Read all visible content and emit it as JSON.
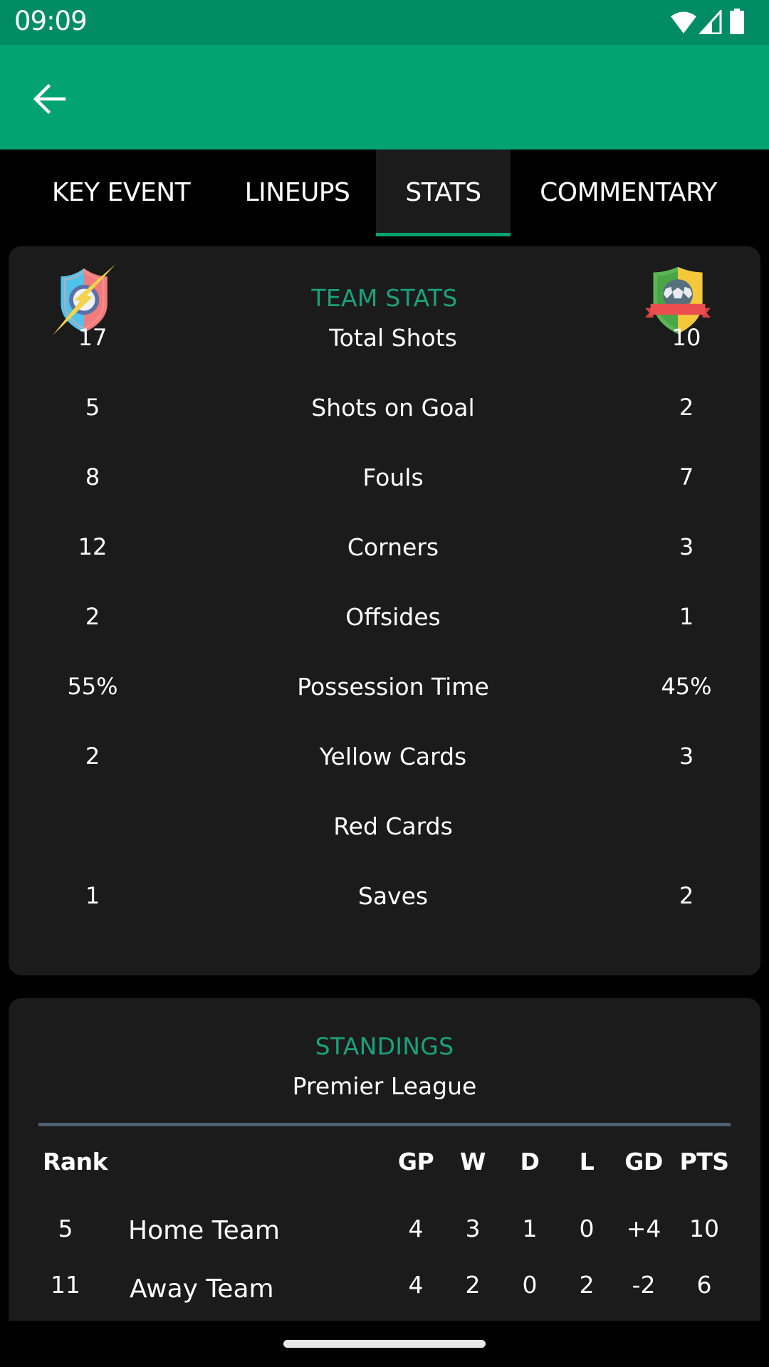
{
  "status_bar": {
    "time": "09:09",
    "icons": [
      "wifi-icon",
      "signal-icon",
      "battery-icon"
    ]
  },
  "app_bar": {
    "back_icon": "arrow-left-icon"
  },
  "tabs": [
    {
      "label": "KEY EVENT",
      "active": false
    },
    {
      "label": "LINEUPS",
      "active": false
    },
    {
      "label": "STATS",
      "active": true
    },
    {
      "label": "COMMENTARY",
      "active": false
    }
  ],
  "team_stats": {
    "title": "TEAM STATS",
    "home_logo": "home-team-crest-lightning-icon",
    "away_logo": "away-team-crest-ribbon-icon",
    "rows": [
      {
        "home": "17",
        "label": "Total Shots",
        "away": "10"
      },
      {
        "home": "5",
        "label": "Shots on Goal",
        "away": "2"
      },
      {
        "home": "8",
        "label": "Fouls",
        "away": "7"
      },
      {
        "home": "12",
        "label": "Corners",
        "away": "3"
      },
      {
        "home": "2",
        "label": "Offsides",
        "away": "1"
      },
      {
        "home": "55%",
        "label": "Possession Time",
        "away": "45%"
      },
      {
        "home": "2",
        "label": "Yellow Cards",
        "away": "3"
      },
      {
        "home": "",
        "label": "Red Cards",
        "away": ""
      },
      {
        "home": "1",
        "label": "Saves",
        "away": "2"
      }
    ]
  },
  "standings": {
    "title": "STANDINGS",
    "league": "Premier League",
    "headers": {
      "rank": "Rank",
      "gp": "GP",
      "w": "W",
      "d": "D",
      "l": "L",
      "gd": "GD",
      "pts": "PTS"
    },
    "rows": [
      {
        "rank": "5",
        "team": "Home Team",
        "gp": "4",
        "w": "3",
        "d": "1",
        "l": "0",
        "gd": "+4",
        "pts": "10"
      },
      {
        "rank": "11",
        "team": "Away Team",
        "gp": "4",
        "w": "2",
        "d": "0",
        "l": "2",
        "gd": "-2",
        "pts": "6"
      }
    ]
  },
  "colors": {
    "status_bar": "#028c65",
    "app_bar": "#02a271",
    "accent": "#19a278",
    "card_bg": "#1b1b1b",
    "divider": "#4e6170"
  }
}
